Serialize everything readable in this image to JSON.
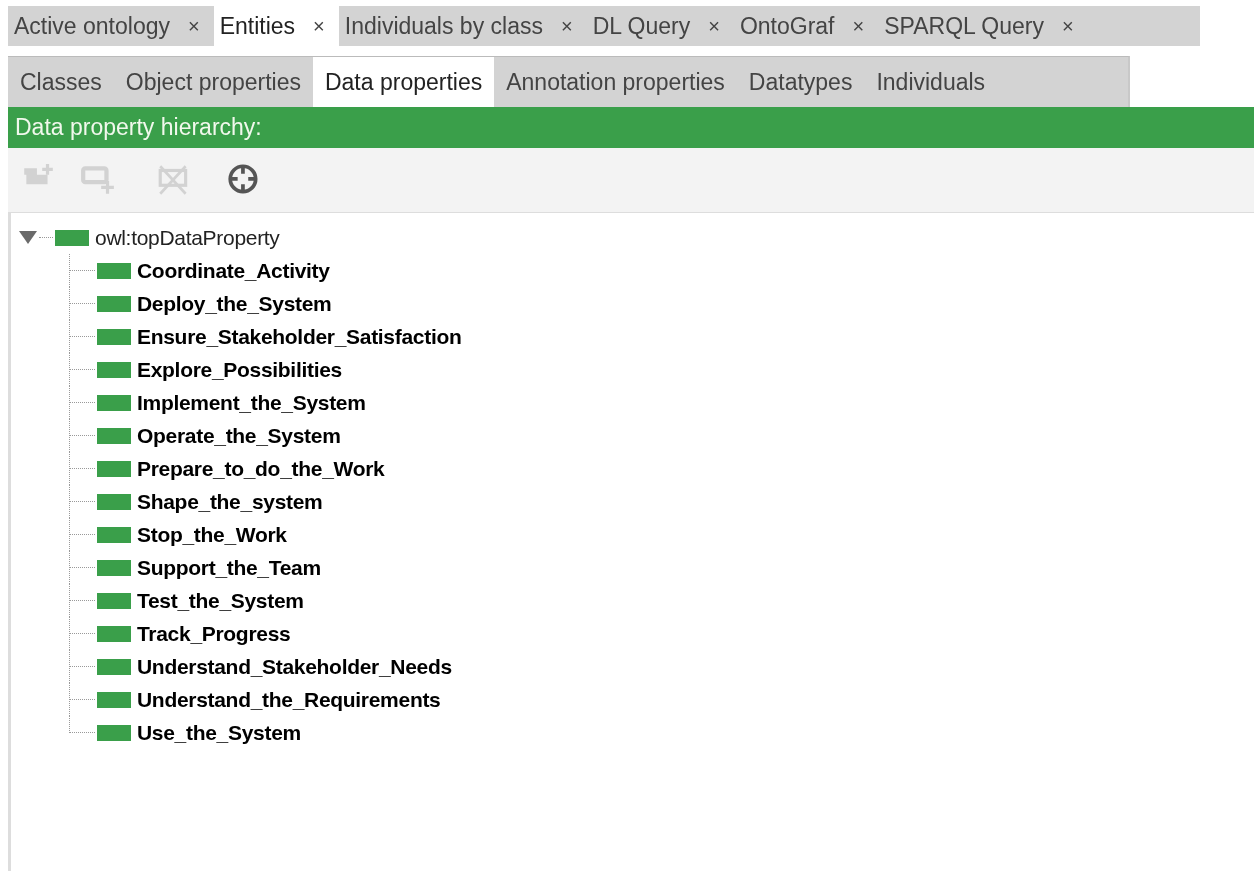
{
  "workspace_tabs": [
    {
      "label": "Active ontology",
      "close": "×",
      "selected": false
    },
    {
      "label": "Entities",
      "close": "×",
      "selected": true
    },
    {
      "label": "Individuals by class",
      "close": "×",
      "selected": false
    },
    {
      "label": "DL Query",
      "close": "×",
      "selected": false
    },
    {
      "label": "OntoGraf",
      "close": "×",
      "selected": false
    },
    {
      "label": "SPARQL Query",
      "close": "×",
      "selected": false
    }
  ],
  "entity_tabs": [
    {
      "label": "Classes",
      "selected": false
    },
    {
      "label": "Object properties",
      "selected": false
    },
    {
      "label": "Data properties",
      "selected": true
    },
    {
      "label": "Annotation properties",
      "selected": false
    },
    {
      "label": "Datatypes",
      "selected": false
    },
    {
      "label": "Individuals",
      "selected": false
    }
  ],
  "view_header": {
    "title": "Data property hierarchy:"
  },
  "toolbar": [
    {
      "kind": "add-sub",
      "disabled": true
    },
    {
      "kind": "add-sibling",
      "disabled": true
    },
    {
      "kind": "delete",
      "disabled": true
    },
    {
      "kind": "find",
      "disabled": false
    }
  ],
  "tree": {
    "label": "owl:topDataProperty",
    "expanded": true,
    "children": [
      {
        "label": "Coordinate_Activity"
      },
      {
        "label": "Deploy_the_System"
      },
      {
        "label": "Ensure_Stakeholder_Satisfaction"
      },
      {
        "label": "Explore_Possibilities"
      },
      {
        "label": "Implement_the_System"
      },
      {
        "label": "Operate_the_System"
      },
      {
        "label": "Prepare_to_do_the_Work"
      },
      {
        "label": "Shape_the_system"
      },
      {
        "label": "Stop_the_Work"
      },
      {
        "label": "Support_the_Team"
      },
      {
        "label": "Test_the_System"
      },
      {
        "label": "Track_Progress"
      },
      {
        "label": "Understand_Stakeholder_Needs"
      },
      {
        "label": "Understand_the_Requirements"
      },
      {
        "label": "Use_the_System"
      }
    ]
  }
}
